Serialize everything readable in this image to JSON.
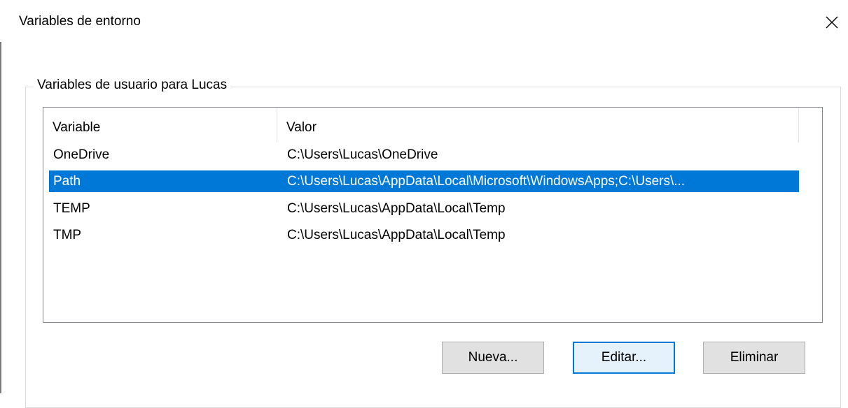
{
  "window": {
    "title": "Variables de entorno"
  },
  "user_group": {
    "legend": "Variables de usuario para Lucas",
    "columns": [
      "Variable",
      "Valor"
    ],
    "rows": [
      {
        "variable": "OneDrive",
        "value": "C:\\Users\\Lucas\\OneDrive",
        "selected": false
      },
      {
        "variable": "Path",
        "value": "C:\\Users\\Lucas\\AppData\\Local\\Microsoft\\WindowsApps;C:\\Users\\...",
        "selected": true
      },
      {
        "variable": "TEMP",
        "value": "C:\\Users\\Lucas\\AppData\\Local\\Temp",
        "selected": false
      },
      {
        "variable": "TMP",
        "value": "C:\\Users\\Lucas\\AppData\\Local\\Temp",
        "selected": false
      }
    ],
    "buttons": {
      "new_label": "Nueva...",
      "edit_label": "Editar...",
      "delete_label": "Eliminar"
    }
  },
  "icons": {
    "close": "close-icon"
  },
  "colors": {
    "selection": "#0078d7",
    "button_face": "#e1e1e1",
    "button_focus_face": "#e5f1fb",
    "button_focus_border": "#0078d7"
  }
}
